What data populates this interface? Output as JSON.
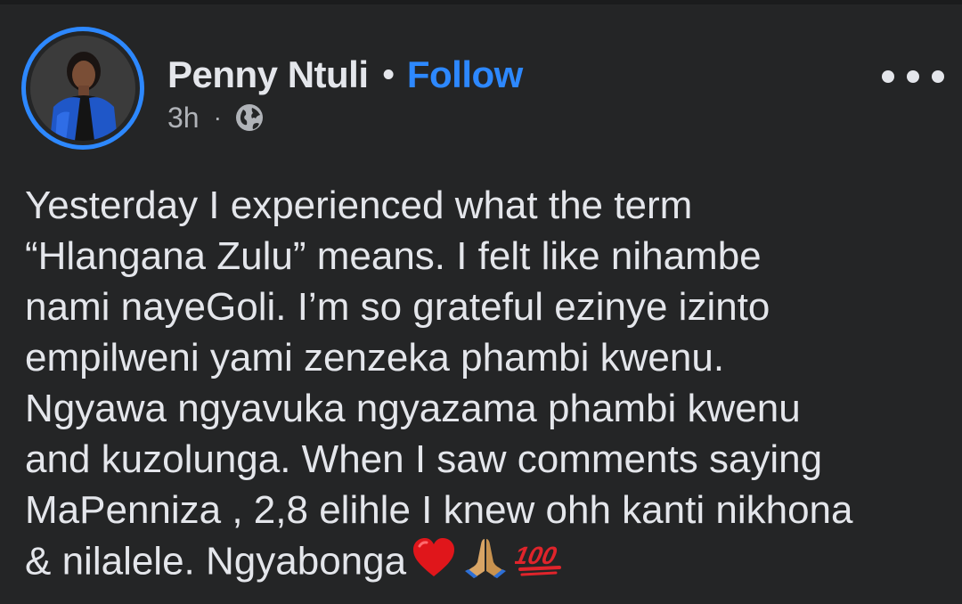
{
  "post": {
    "author": "Penny Ntuli",
    "separator": "•",
    "follow_label": "Follow",
    "time": "3h",
    "meta_separator": "·",
    "audience_icon": "globe-icon",
    "more_icon": "more-options-icon",
    "body_lines": [
      "Yesterday I experienced what the term",
      "“Hlangana Zulu” means. I felt like nihambe",
      "nami nayeGoli. I’m so grateful ezinye izinto",
      "empilweni yami zenzeka phambi kwenu.",
      "Ngyawa ngyavuka ngyazama phambi kwenu",
      "and kuzolunga. When I saw comments saying",
      "MaPenniza , 2,8 elihle I knew ohh kanti nikhona",
      "& nilalele. Ngyabonga"
    ],
    "emojis": [
      "heart-emoji",
      "folded-hands-emoji",
      "hundred-points-emoji"
    ]
  },
  "colors": {
    "background": "#242526",
    "text": "#e4e6eb",
    "secondary_text": "#b0b3b8",
    "accent": "#2d88ff"
  }
}
